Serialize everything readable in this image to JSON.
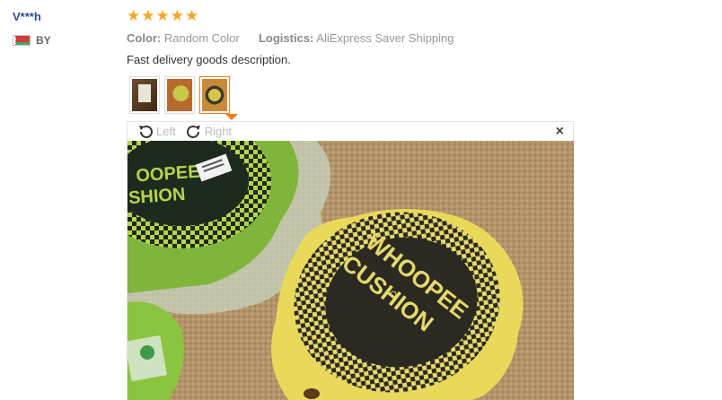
{
  "reviewer": {
    "name": "V***h",
    "country_code": "BY"
  },
  "review": {
    "rating": 5,
    "color_label": "Color:",
    "color_value": "Random Color",
    "logistics_label": "Logistics:",
    "logistics_value": "AliExpress Saver Shipping",
    "feedback_text": "Fast delivery goods description."
  },
  "thumbnails": [
    {
      "name": "photo-thumb-package",
      "active": false
    },
    {
      "name": "photo-thumb-cushions",
      "active": false
    },
    {
      "name": "photo-thumb-cushion-closeup",
      "active": true
    }
  ],
  "viewer": {
    "rotate_left_label": "Left",
    "rotate_right_label": "Right",
    "close_glyph": "×",
    "product_text_line1": "WHOOPEE",
    "product_text_line2": "CUSHION"
  },
  "icons": {
    "star": "star-icon",
    "rotate_left": "rotate-left-icon",
    "rotate_right": "rotate-right-icon",
    "close": "close-icon",
    "flag": "flag-icon"
  },
  "colors": {
    "star": "#f5a623",
    "username": "#2a4f8e",
    "accent": "#f37b1d"
  }
}
